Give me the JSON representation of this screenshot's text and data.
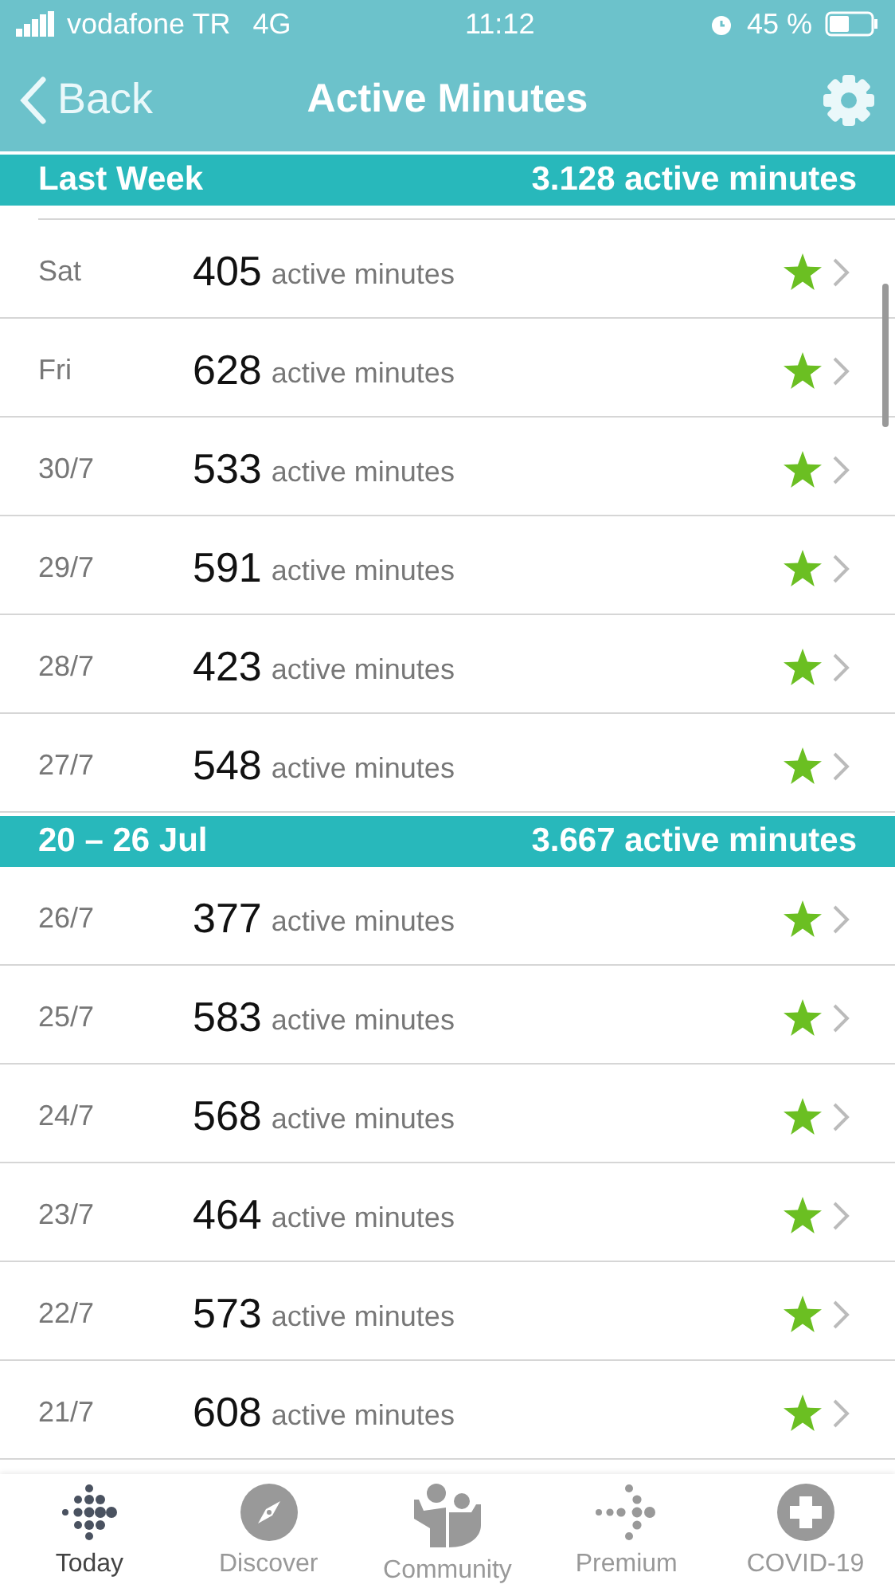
{
  "status_bar": {
    "carrier": "vodafone TR",
    "network": "4G",
    "time": "11:12",
    "battery": "45 %"
  },
  "nav": {
    "back": "Back",
    "title": "Active Minutes"
  },
  "sections": [
    {
      "title": "Last Week",
      "total": "3.128 active minutes",
      "rows": [
        {
          "day": "Sat",
          "value": "405",
          "unit": "active minutes",
          "goal_met": true
        },
        {
          "day": "Fri",
          "value": "628",
          "unit": "active minutes",
          "goal_met": true
        },
        {
          "day": "30/7",
          "value": "533",
          "unit": "active minutes",
          "goal_met": true
        },
        {
          "day": "29/7",
          "value": "591",
          "unit": "active minutes",
          "goal_met": true
        },
        {
          "day": "28/7",
          "value": "423",
          "unit": "active minutes",
          "goal_met": true
        },
        {
          "day": "27/7",
          "value": "548",
          "unit": "active minutes",
          "goal_met": true
        }
      ]
    },
    {
      "title": "20 – 26 Jul",
      "total": "3.667 active minutes",
      "rows": [
        {
          "day": "26/7",
          "value": "377",
          "unit": "active minutes",
          "goal_met": true
        },
        {
          "day": "25/7",
          "value": "583",
          "unit": "active minutes",
          "goal_met": true
        },
        {
          "day": "24/7",
          "value": "568",
          "unit": "active minutes",
          "goal_met": true
        },
        {
          "day": "23/7",
          "value": "464",
          "unit": "active minutes",
          "goal_met": true
        },
        {
          "day": "22/7",
          "value": "573",
          "unit": "active minutes",
          "goal_met": true
        },
        {
          "day": "21/7",
          "value": "608",
          "unit": "active minutes",
          "goal_met": true
        }
      ]
    }
  ],
  "tabs": [
    {
      "label": "Today",
      "kind": "today",
      "selected": true
    },
    {
      "label": "Discover",
      "kind": "discover",
      "selected": false
    },
    {
      "label": "Community",
      "kind": "community",
      "selected": false
    },
    {
      "label": "Premium",
      "kind": "premium",
      "selected": false
    },
    {
      "label": "COVID-19",
      "kind": "covid",
      "selected": false
    }
  ]
}
